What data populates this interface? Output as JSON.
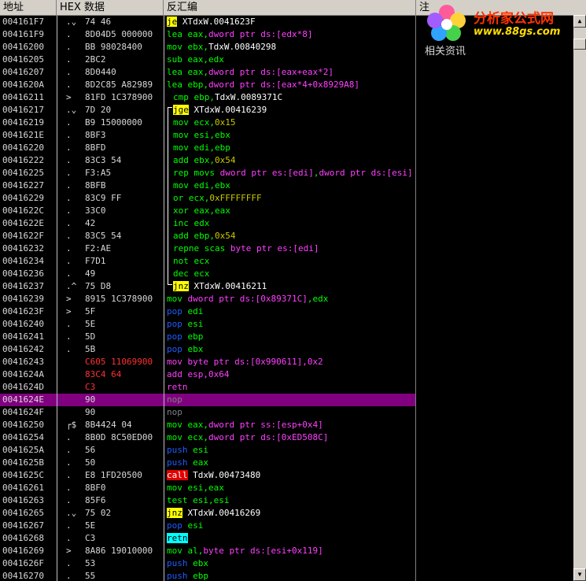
{
  "header": {
    "columns": [
      "地址",
      "HEX 数据",
      "反汇编",
      "注"
    ]
  },
  "right_pane": {
    "logo_text": "分析家公式网",
    "logo_url": "www.88gs.com",
    "related_label": "相关资讯"
  },
  "colors": {
    "selection": "#800080",
    "highlight_yellow": "#ffff00",
    "highlight_red": "#e00000",
    "highlight_cyan": "#00ffff",
    "background": "#000000"
  },
  "selected_row_index": 30,
  "rows": [
    {
      "addr": "004161F7",
      "mark": ".⌄",
      "hex": "74 46",
      "mnem": "je",
      "mc": "hl-y",
      "ops": [
        {
          "t": " XTdxW.0041623F",
          "c": "op-w"
        }
      ]
    },
    {
      "addr": "004161F9",
      "mark": ".",
      "hex": "8D04D5 000000",
      "mnem": "lea",
      "mc": "mn-g",
      "ops": [
        {
          "t": " eax,",
          "c": "op-g"
        },
        {
          "t": "dword ptr ds:[edx*8]",
          "c": "op-m"
        }
      ]
    },
    {
      "addr": "00416200",
      "mark": ".",
      "hex": "BB 98028400",
      "mnem": "mov",
      "mc": "mn-g",
      "ops": [
        {
          "t": " ebx,",
          "c": "op-g"
        },
        {
          "t": "TdxW.00840298",
          "c": "op-w"
        }
      ]
    },
    {
      "addr": "00416205",
      "mark": ".",
      "hex": "2BC2",
      "mnem": "sub",
      "mc": "mn-g",
      "ops": [
        {
          "t": " eax,edx",
          "c": "op-g"
        }
      ]
    },
    {
      "addr": "00416207",
      "mark": ".",
      "hex": "8D0440",
      "mnem": "lea",
      "mc": "mn-g",
      "ops": [
        {
          "t": " eax,",
          "c": "op-g"
        },
        {
          "t": "dword ptr ds:[eax+eax*2]",
          "c": "op-m"
        }
      ]
    },
    {
      "addr": "0041620A",
      "mark": ".",
      "hex": "8D2C85 A82989",
      "mnem": "lea",
      "mc": "mn-g",
      "ops": [
        {
          "t": " ebp,",
          "c": "op-g"
        },
        {
          "t": "dword ptr ds:[eax*4+0x8929A8]",
          "c": "op-m"
        }
      ]
    },
    {
      "addr": "00416211",
      "mark": ">",
      "hex": "81FD 1C378900",
      "mnem": "cmp",
      "mc": "mn-g",
      "ind": true,
      "ops": [
        {
          "t": " ebp,",
          "c": "op-g"
        },
        {
          "t": "TdxW.0089371C",
          "c": "op-w"
        }
      ]
    },
    {
      "addr": "00416217",
      "mark": ".⌄",
      "hex": "7D 20",
      "mnem": "jge",
      "mc": "hl-y",
      "ind": true,
      "ops": [
        {
          "t": " XTdxW.00416239",
          "c": "op-w"
        }
      ]
    },
    {
      "addr": "00416219",
      "mark": ".",
      "hex": "B9 15000000",
      "mnem": "mov",
      "mc": "mn-g",
      "ind": true,
      "ops": [
        {
          "t": " ecx,",
          "c": "op-g"
        },
        {
          "t": "0x15",
          "c": "op-y"
        }
      ]
    },
    {
      "addr": "0041621E",
      "mark": ".",
      "hex": "8BF3",
      "mnem": "mov",
      "mc": "mn-g",
      "ind": true,
      "ops": [
        {
          "t": " esi,ebx",
          "c": "op-g"
        }
      ]
    },
    {
      "addr": "00416220",
      "mark": ".",
      "hex": "8BFD",
      "mnem": "mov",
      "mc": "mn-g",
      "ind": true,
      "ops": [
        {
          "t": " edi,ebp",
          "c": "op-g"
        }
      ]
    },
    {
      "addr": "00416222",
      "mark": ".",
      "hex": "83C3 54",
      "mnem": "add",
      "mc": "mn-g",
      "ind": true,
      "ops": [
        {
          "t": " ebx,",
          "c": "op-g"
        },
        {
          "t": "0x54",
          "c": "op-y"
        }
      ]
    },
    {
      "addr": "00416225",
      "mark": ".",
      "hex": "F3:A5",
      "mnem": "rep movs",
      "mc": "mn-g",
      "ind": true,
      "ops": [
        {
          "t": " dword ptr es:[edi]",
          "c": "op-m"
        },
        {
          "t": ",",
          "c": "op-g"
        },
        {
          "t": "dword ptr ds:[esi]",
          "c": "op-m"
        }
      ]
    },
    {
      "addr": "00416227",
      "mark": ".",
      "hex": "8BFB",
      "mnem": "mov",
      "mc": "mn-g",
      "ind": true,
      "ops": [
        {
          "t": " edi,ebx",
          "c": "op-g"
        }
      ]
    },
    {
      "addr": "00416229",
      "mark": ".",
      "hex": "83C9 FF",
      "mnem": "or",
      "mc": "mn-g",
      "ind": true,
      "ops": [
        {
          "t": " ecx,",
          "c": "op-g"
        },
        {
          "t": "0xFFFFFFFF",
          "c": "op-y"
        }
      ]
    },
    {
      "addr": "0041622C",
      "mark": ".",
      "hex": "33C0",
      "mnem": "xor",
      "mc": "mn-g",
      "ind": true,
      "ops": [
        {
          "t": " eax,eax",
          "c": "op-g"
        }
      ]
    },
    {
      "addr": "0041622E",
      "mark": ".",
      "hex": "42",
      "mnem": "inc",
      "mc": "mn-g",
      "ind": true,
      "ops": [
        {
          "t": " edx",
          "c": "op-g"
        }
      ]
    },
    {
      "addr": "0041622F",
      "mark": ".",
      "hex": "83C5 54",
      "mnem": "add",
      "mc": "mn-g",
      "ind": true,
      "ops": [
        {
          "t": " ebp,",
          "c": "op-g"
        },
        {
          "t": "0x54",
          "c": "op-y"
        }
      ]
    },
    {
      "addr": "00416232",
      "mark": ".",
      "hex": "F2:AE",
      "mnem": "repne scas",
      "mc": "mn-g",
      "ind": true,
      "ops": [
        {
          "t": " byte ptr es:[edi]",
          "c": "op-m"
        }
      ]
    },
    {
      "addr": "00416234",
      "mark": ".",
      "hex": "F7D1",
      "mnem": "not",
      "mc": "mn-g",
      "ind": true,
      "ops": [
        {
          "t": " ecx",
          "c": "op-g"
        }
      ]
    },
    {
      "addr": "00416236",
      "mark": ".",
      "hex": "49",
      "mnem": "dec",
      "mc": "mn-g",
      "ind": true,
      "ops": [
        {
          "t": " ecx",
          "c": "op-g"
        }
      ]
    },
    {
      "addr": "00416237",
      "mark": ".^",
      "hex": "75 D8",
      "mnem": "jnz",
      "mc": "hl-y",
      "ind": true,
      "ops": [
        {
          "t": " XTdxW.00416211",
          "c": "op-w"
        }
      ]
    },
    {
      "addr": "00416239",
      "mark": ">",
      "hex": "8915 1C378900",
      "mnem": "mov",
      "mc": "mn-g",
      "ops": [
        {
          "t": " dword ptr ds:[0x89371C]",
          "c": "op-m"
        },
        {
          "t": ",edx",
          "c": "op-g"
        }
      ]
    },
    {
      "addr": "0041623F",
      "mark": ">",
      "hex": "5F",
      "mnem": "pop",
      "mc": "mn-b",
      "ops": [
        {
          "t": " edi",
          "c": "op-g"
        }
      ]
    },
    {
      "addr": "00416240",
      "mark": ".",
      "hex": "5E",
      "mnem": "pop",
      "mc": "mn-b",
      "ops": [
        {
          "t": " esi",
          "c": "op-g"
        }
      ]
    },
    {
      "addr": "00416241",
      "mark": ".",
      "hex": "5D",
      "mnem": "pop",
      "mc": "mn-b",
      "ops": [
        {
          "t": " ebp",
          "c": "op-g"
        }
      ]
    },
    {
      "addr": "00416242",
      "mark": ".",
      "hex": "5B",
      "mnem": "pop",
      "mc": "mn-b",
      "ops": [
        {
          "t": " ebx",
          "c": "op-g"
        }
      ]
    },
    {
      "addr": "00416243",
      "mark": "",
      "hex": "C605 11069900",
      "hr": true,
      "mnem": "mov",
      "mc": "mn-m",
      "ops": [
        {
          "t": " byte ptr ds:[0x990611],0x2",
          "c": "op-m"
        }
      ]
    },
    {
      "addr": "0041624A",
      "mark": "",
      "hex": "83C4 64",
      "hr": true,
      "mnem": "add",
      "mc": "mn-m",
      "ops": [
        {
          "t": " esp,0x64",
          "c": "op-m"
        }
      ]
    },
    {
      "addr": "0041624D",
      "mark": "",
      "hex": "C3",
      "hr": true,
      "mnem": "retn",
      "mc": "mn-m",
      "ops": []
    },
    {
      "addr": "0041624E",
      "mark": "",
      "hex": "90",
      "mnem": "nop",
      "mc": "mn-gr",
      "ops": []
    },
    {
      "addr": "0041624F",
      "mark": "",
      "hex": "90",
      "mnem": "nop",
      "mc": "mn-gr",
      "ops": []
    },
    {
      "addr": "00416250",
      "mark": "┌$",
      "hex": "8B4424 04",
      "mnem": "mov",
      "mc": "mn-g",
      "ops": [
        {
          "t": " eax,",
          "c": "op-g"
        },
        {
          "t": "dword ptr ss:[esp+0x4]",
          "c": "op-m"
        }
      ]
    },
    {
      "addr": "00416254",
      "mark": ".",
      "hex": "8B0D 8C50ED00",
      "mnem": "mov",
      "mc": "mn-g",
      "ops": [
        {
          "t": " ecx,",
          "c": "op-g"
        },
        {
          "t": "dword ptr ds:[0xED508C]",
          "c": "op-m"
        }
      ]
    },
    {
      "addr": "0041625A",
      "mark": ".",
      "hex": "56",
      "mnem": "push",
      "mc": "mn-b",
      "ops": [
        {
          "t": " esi",
          "c": "op-g"
        }
      ]
    },
    {
      "addr": "0041625B",
      "mark": ".",
      "hex": "50",
      "mnem": "push",
      "mc": "mn-b",
      "ops": [
        {
          "t": " eax",
          "c": "op-g"
        }
      ]
    },
    {
      "addr": "0041625C",
      "mark": ".",
      "hex": "E8 1FD20500",
      "mnem": "call",
      "mc": "hl-r",
      "ops": [
        {
          "t": " TdxW.00473480",
          "c": "op-w"
        }
      ]
    },
    {
      "addr": "00416261",
      "mark": ".",
      "hex": "8BF0",
      "mnem": "mov",
      "mc": "mn-g",
      "ops": [
        {
          "t": " esi,eax",
          "c": "op-g"
        }
      ]
    },
    {
      "addr": "00416263",
      "mark": ".",
      "hex": "85F6",
      "mnem": "test",
      "mc": "mn-g",
      "ops": [
        {
          "t": " esi,esi",
          "c": "op-g"
        }
      ]
    },
    {
      "addr": "00416265",
      "mark": ".⌄",
      "hex": "75 02",
      "mnem": "jnz",
      "mc": "hl-y",
      "ops": [
        {
          "t": " XTdxW.00416269",
          "c": "op-w"
        }
      ]
    },
    {
      "addr": "00416267",
      "mark": ".",
      "hex": "5E",
      "mnem": "pop",
      "mc": "mn-b",
      "ops": [
        {
          "t": " esi",
          "c": "op-g"
        }
      ]
    },
    {
      "addr": "00416268",
      "mark": ".",
      "hex": "C3",
      "mnem": "retn",
      "mc": "hl-c",
      "ops": []
    },
    {
      "addr": "00416269",
      "mark": ">",
      "hex": "8A86 19010000",
      "mnem": "mov",
      "mc": "mn-g",
      "ops": [
        {
          "t": " al,",
          "c": "op-g"
        },
        {
          "t": "byte ptr ds:[esi+0x119]",
          "c": "op-m"
        }
      ]
    },
    {
      "addr": "0041626F",
      "mark": ".",
      "hex": "53",
      "mnem": "push",
      "mc": "mn-b",
      "ops": [
        {
          "t": " ebx",
          "c": "op-g"
        }
      ]
    },
    {
      "addr": "00416270",
      "mark": ".",
      "hex": "55",
      "mnem": "push",
      "mc": "mn-b",
      "ops": [
        {
          "t": " ebp",
          "c": "op-g"
        }
      ]
    }
  ]
}
